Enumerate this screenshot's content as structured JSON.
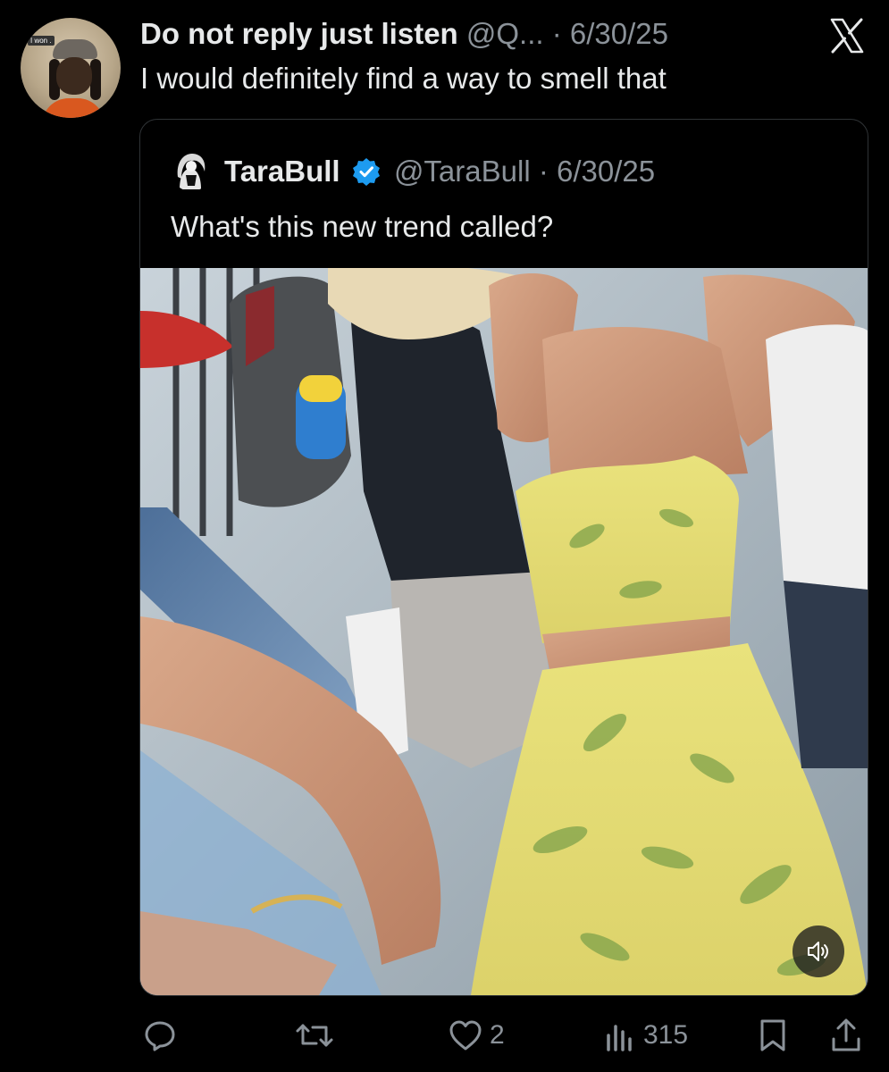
{
  "post": {
    "author_name": "Do not reply just listen",
    "handle": "@Q...",
    "separator": "·",
    "date": "6/30/25",
    "text": "I would definitely find a way to smell that",
    "avatar_tag": "I won ."
  },
  "quote": {
    "author_name": "TaraBull",
    "handle": "@TaraBull",
    "separator": "·",
    "date": "6/30/25",
    "text": "What's this new trend called?"
  },
  "actions": {
    "likes": "2",
    "views": "315"
  },
  "icons": {
    "close": "x-logo-icon",
    "verified": "verified-badge-icon",
    "sound": "speaker-icon",
    "reply": "reply-icon",
    "repost": "repost-icon",
    "like": "heart-icon",
    "views": "views-icon",
    "bookmark": "bookmark-icon",
    "share": "share-icon"
  },
  "colors": {
    "background": "#000000",
    "text": "#e7e9ea",
    "muted": "#8b9299",
    "verified": "#1d9bf0",
    "dress_yellow": "#e8e27a"
  }
}
